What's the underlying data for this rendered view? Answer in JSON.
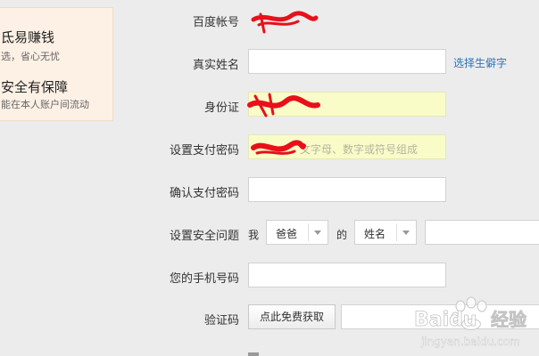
{
  "promo": {
    "title1": "氐易赚钱",
    "sub1": "选，省心无忧",
    "title2": "安全有保障",
    "sub2": "能在本人账户间流动"
  },
  "form": {
    "account_label": "百度帐号",
    "realname_label": "真实姓名",
    "realname_link": "选择生僻字",
    "id_label": "身份证",
    "paypwd_label": "设置支付密码",
    "paypwd_placeholder": "文字母、数字或符号组成",
    "confirm_label": "确认支付密码",
    "question_label": "设置安全问题",
    "question_prefix": "我",
    "question_relation": "爸爸",
    "question_of": "的",
    "question_attr": "姓名",
    "phone_label": "您的手机号码",
    "captcha_label": "验证码",
    "captcha_button": "点此免费获取"
  },
  "watermark": {
    "brand": "Baidu",
    "brand_cn": "经验",
    "url": "jingyan.baidu.com"
  },
  "colors": {
    "scribble": "#e8101a",
    "link": "#2b73b8",
    "highlight_field": "#fafcc8"
  }
}
